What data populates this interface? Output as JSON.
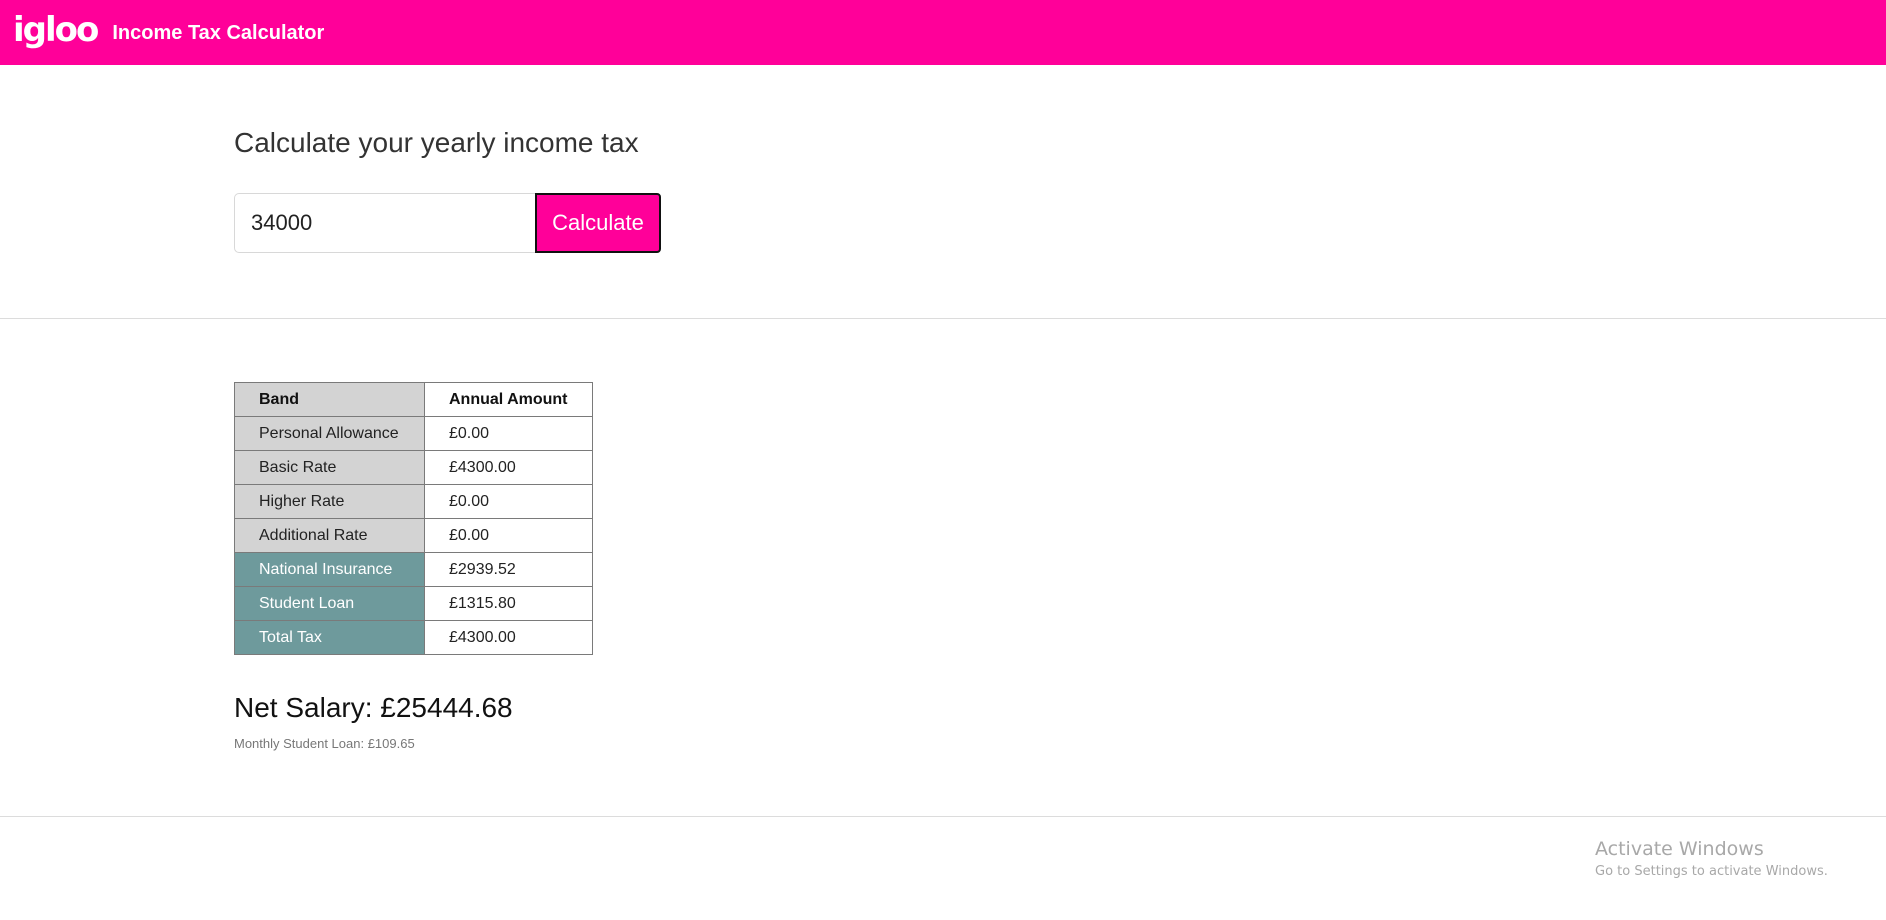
{
  "header": {
    "logo_text": "igloo",
    "title": "Income Tax Calculator",
    "background_color": "#ff0099"
  },
  "calculator": {
    "heading": "Calculate your yearly income tax",
    "income_value": "34000",
    "calculate_label": "Calculate"
  },
  "results": {
    "table": {
      "headers": [
        "Band",
        "Annual Amount"
      ],
      "rows": [
        {
          "band": "Personal Allowance",
          "amount": "£0.00",
          "style": "grey"
        },
        {
          "band": "Basic Rate",
          "amount": "£4300.00",
          "style": "grey"
        },
        {
          "band": "Higher Rate",
          "amount": "£0.00",
          "style": "grey"
        },
        {
          "band": "Additional Rate",
          "amount": "£0.00",
          "style": "grey"
        },
        {
          "band": "National Insurance",
          "amount": "£2939.52",
          "style": "teal"
        },
        {
          "band": "Student Loan",
          "amount": "£1315.80",
          "style": "teal"
        },
        {
          "band": "Total Tax",
          "amount": "£4300.00",
          "style": "teal"
        }
      ]
    },
    "net_salary": "Net Salary: £25444.68",
    "monthly_student_loan": "Monthly Student Loan: £109.65"
  },
  "os_watermark": {
    "title": "Activate Windows",
    "subtitle": "Go to Settings to activate Windows."
  },
  "colors": {
    "accent": "#ff0099",
    "band_grey": "#d3d3d3",
    "band_teal": "#6e9a9c"
  }
}
